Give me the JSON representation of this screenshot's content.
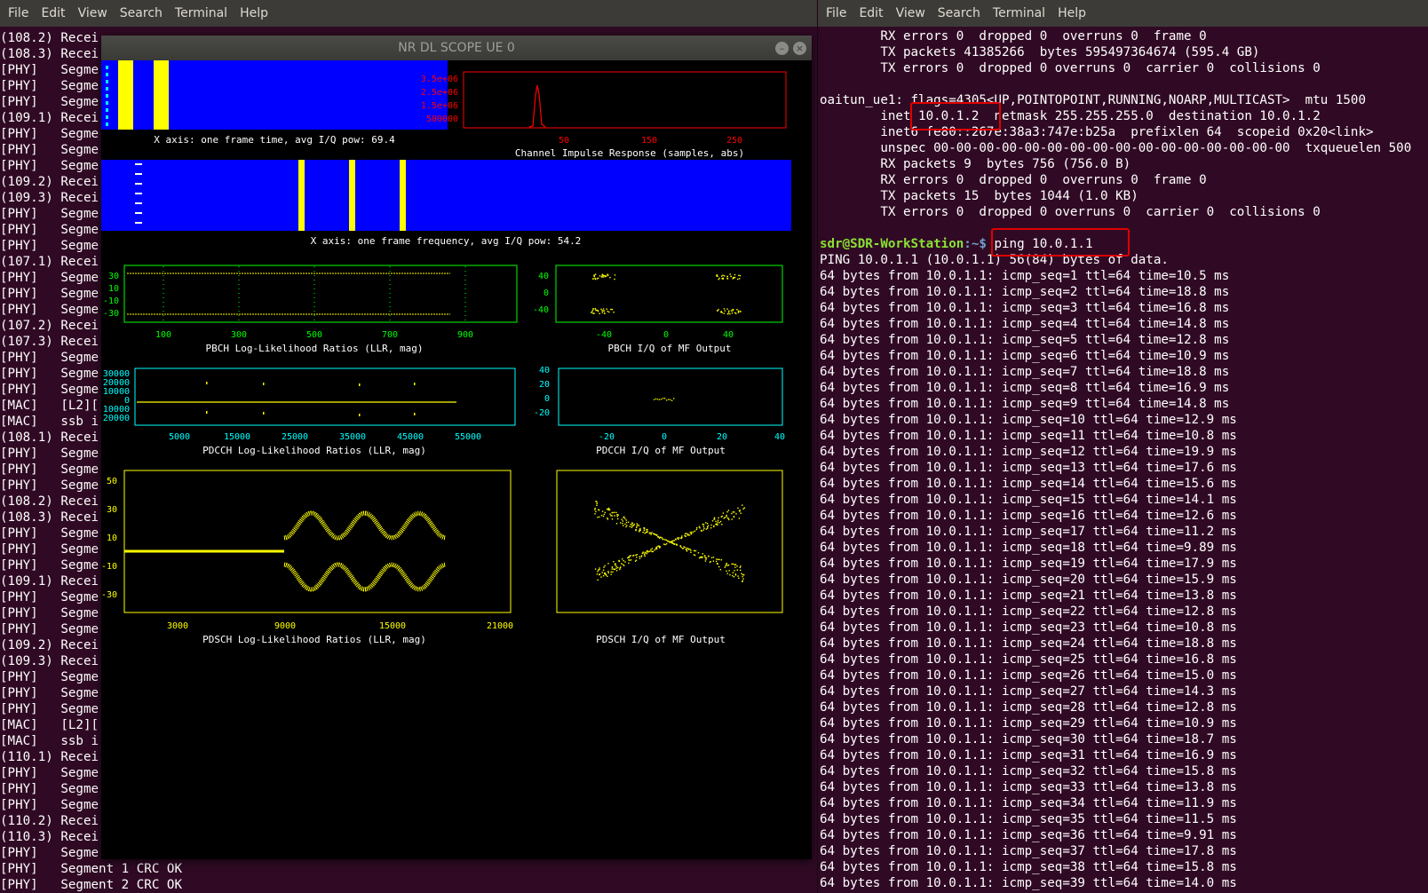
{
  "left_terminal": {
    "menu": [
      "File",
      "Edit",
      "View",
      "Search",
      "Terminal",
      "Help"
    ],
    "lines": [
      "(108.2) Recei",
      "(108.3) Recei",
      "[PHY]   Segme",
      "[PHY]   Segme",
      "[PHY]   Segme",
      "(109.1) Recei",
      "[PHY]   Segme",
      "[PHY]   Segme",
      "[PHY]   Segme",
      "(109.2) Recei",
      "(109.3) Recei",
      "[PHY]   Segme",
      "[PHY]   Segme",
      "[PHY]   Segme",
      "(107.1) Recei",
      "[PHY]   Segme",
      "[PHY]   Segme",
      "[PHY]   Segme",
      "(107.2) Recei",
      "(107.3) Recei",
      "[PHY]   Segme",
      "[PHY]   Segme",
      "[PHY]   Segme",
      "[MAC]   [L2][",
      "[MAC]   ssb i",
      "(108.1) Recei",
      "[PHY]   Segme",
      "[PHY]   Segme",
      "[PHY]   Segme",
      "(108.2) Recei",
      "(108.3) Recei",
      "[PHY]   Segme",
      "[PHY]   Segme",
      "[PHY]   Segme",
      "(109.1) Recei",
      "[PHY]   Segme",
      "[PHY]   Segme",
      "[PHY]   Segme",
      "(109.2) Recei",
      "(109.3) Recei",
      "[PHY]   Segme",
      "[PHY]   Segme",
      "[PHY]   Segme",
      "[MAC]   [L2][",
      "[MAC]   ssb i",
      "(110.1) Recei",
      "[PHY]   Segme",
      "[PHY]   Segme",
      "[PHY]   Segme",
      "(110.2) Recei",
      "(110.3) Recei",
      "[PHY]   Segme",
      "[PHY]   Segment 1 CRC OK",
      "[PHY]   Segment 2 CRC OK"
    ]
  },
  "scope": {
    "title": "NR DL SCOPE UE 0",
    "captions": {
      "time": "X axis: one frame time, avg I/Q pow: 69.4",
      "cir": "Channel Impulse Response (samples, abs)",
      "freq": "X axis: one frame frequency, avg I/Q pow: 54.2",
      "pbch_llr": "PBCH Log-Likelihood Ratios (LLR, mag)",
      "pbch_iq": "PBCH I/Q of MF Output",
      "pdcch_llr": "PDCCH Log-Likelihood Ratios (LLR, mag)",
      "pdcch_iq": "PDCCH I/Q of MF Output",
      "pdsch_llr": "PDSCH Log-Likelihood Ratios (LLR, mag)",
      "pdsch_iq": "PDSCH I/Q of MF Output"
    },
    "ticks": {
      "cir_y": [
        "3.5e+06",
        "2.5e+06",
        "1.5e+06",
        "500000"
      ],
      "cir_x": [
        "50",
        "150",
        "250"
      ],
      "pbch_llr_y": [
        "30",
        "10",
        "-10",
        "-30"
      ],
      "pbch_llr_x": [
        "100",
        "300",
        "500",
        "700",
        "900"
      ],
      "pbch_iq_y": [
        "40",
        "0",
        "-40"
      ],
      "pbch_iq_x": [
        "-40",
        "0",
        "40"
      ],
      "pdcch_llr_y": [
        "30000",
        "20000",
        "10000",
        "0",
        "-10000",
        "-20000"
      ],
      "pdcch_llr_x": [
        "5000",
        "15000",
        "25000",
        "35000",
        "45000",
        "55000"
      ],
      "pdcch_iq_y": [
        "40",
        "20",
        "0",
        "-20"
      ],
      "pdcch_iq_x": [
        "-20",
        "0",
        "20",
        "40"
      ],
      "pdsch_llr_y": [
        "50",
        "30",
        "10",
        "-10",
        "-30"
      ],
      "pdsch_llr_x": [
        "3000",
        "9000",
        "15000",
        "21000"
      ]
    },
    "colors": {
      "spectrum_bg": "#0000ff",
      "spectrum_marker": "#ffff00",
      "cir": "#ff0000",
      "pbch": "#00ff00",
      "pdcch": "#00ffff",
      "pdsch": "#ffff00",
      "trace": "#ffff00"
    }
  },
  "right_terminal": {
    "menu": [
      "File",
      "Edit",
      "View",
      "Search",
      "Terminal",
      "Help"
    ],
    "lines": [
      "        RX errors 0  dropped 0  overruns 0  frame 0",
      "        TX packets 41385266  bytes 595497364674 (595.4 GB)",
      "        TX errors 0  dropped 0 overruns 0  carrier 0  collisions 0",
      "",
      "oaitun_ue1: flags=4305<UP,POINTOPOINT,RUNNING,NOARP,MULTICAST>  mtu 1500",
      "        inet 10.0.1.2  netmask 255.255.255.0  destination 10.0.1.2",
      "        inet6 fe80::267e:38a3:747e:b25a  prefixlen 64  scopeid 0x20<link>",
      "        unspec 00-00-00-00-00-00-00-00-00-00-00-00-00-00-00-00  txqueuelen 500",
      "        RX packets 9  bytes 756 (756.0 B)",
      "        RX errors 0  dropped 0  overruns 0  frame 0",
      "        TX packets 15  bytes 1044 (1.0 KB)",
      "        TX errors 0  dropped 0 overruns 0  carrier 0  collisions 0",
      ""
    ],
    "prompt": {
      "user_host": "sdr@SDR-WorkStation",
      "path": ":~$",
      "command": " ping 10.0.1.1"
    },
    "ping_header": "PING 10.0.1.1 (10.0.1.1) 56(84) bytes of data.",
    "ping_target": "10.0.1.1",
    "ping_ttl": 64,
    "ping_times": [
      "10.5",
      "18.8",
      "16.8",
      "14.8",
      "12.8",
      "10.9",
      "18.8",
      "16.9",
      "14.8",
      "12.9",
      "10.8",
      "19.9",
      "17.6",
      "15.6",
      "14.1",
      "12.6",
      "11.2",
      "9.89",
      "17.9",
      "15.9",
      "13.8",
      "12.8",
      "10.8",
      "18.8",
      "16.8",
      "15.0",
      "14.3",
      "12.8",
      "10.9",
      "18.7",
      "16.9",
      "15.8",
      "13.8",
      "11.9",
      "11.5",
      "9.91",
      "17.8",
      "15.8",
      "14.0"
    ]
  }
}
